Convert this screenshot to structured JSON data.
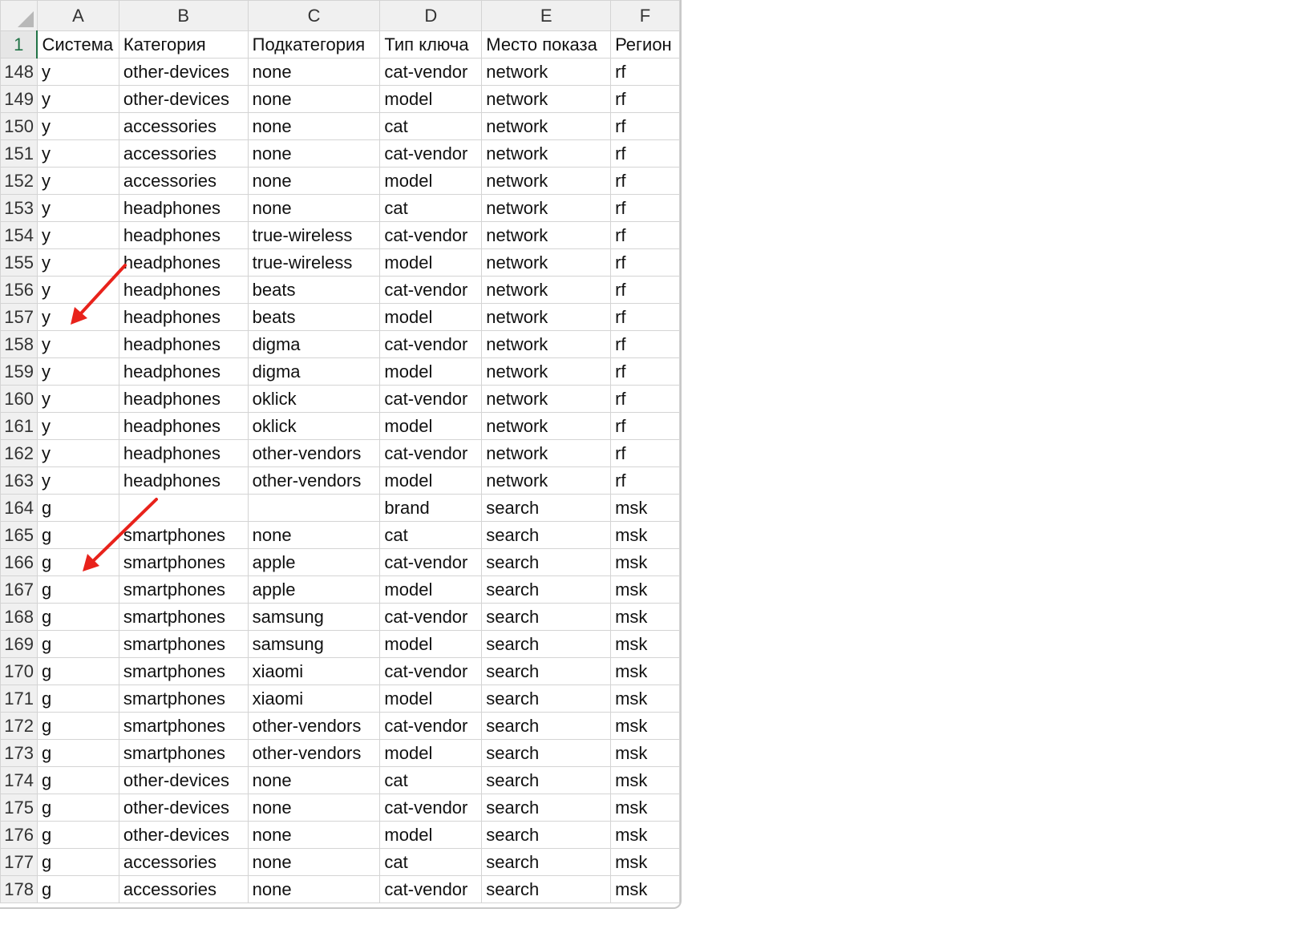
{
  "columns": [
    "A",
    "B",
    "C",
    "D",
    "E",
    "F"
  ],
  "header_row": {
    "number": "1",
    "cells": [
      "Система",
      "Категория",
      "Подкатегория",
      "Тип ключа",
      "Место показа",
      "Регион"
    ]
  },
  "rows": [
    {
      "n": "148",
      "cells": [
        "y",
        "other-devices",
        "none",
        "cat-vendor",
        "network",
        "rf"
      ]
    },
    {
      "n": "149",
      "cells": [
        "y",
        "other-devices",
        "none",
        "model",
        "network",
        "rf"
      ]
    },
    {
      "n": "150",
      "cells": [
        "y",
        "accessories",
        "none",
        "cat",
        "network",
        "rf"
      ]
    },
    {
      "n": "151",
      "cells": [
        "y",
        "accessories",
        "none",
        "cat-vendor",
        "network",
        "rf"
      ]
    },
    {
      "n": "152",
      "cells": [
        "y",
        "accessories",
        "none",
        "model",
        "network",
        "rf"
      ]
    },
    {
      "n": "153",
      "cells": [
        "y",
        "headphones",
        "none",
        "cat",
        "network",
        "rf"
      ]
    },
    {
      "n": "154",
      "cells": [
        "y",
        "headphones",
        "true-wireless",
        "cat-vendor",
        "network",
        "rf"
      ]
    },
    {
      "n": "155",
      "cells": [
        "y",
        "headphones",
        "true-wireless",
        "model",
        "network",
        "rf"
      ]
    },
    {
      "n": "156",
      "cells": [
        "y",
        "headphones",
        "beats",
        "cat-vendor",
        "network",
        "rf"
      ]
    },
    {
      "n": "157",
      "cells": [
        "y",
        "headphones",
        "beats",
        "model",
        "network",
        "rf"
      ]
    },
    {
      "n": "158",
      "cells": [
        "y",
        "headphones",
        "digma",
        "cat-vendor",
        "network",
        "rf"
      ]
    },
    {
      "n": "159",
      "cells": [
        "y",
        "headphones",
        "digma",
        "model",
        "network",
        "rf"
      ]
    },
    {
      "n": "160",
      "cells": [
        "y",
        "headphones",
        "oklick",
        "cat-vendor",
        "network",
        "rf"
      ]
    },
    {
      "n": "161",
      "cells": [
        "y",
        "headphones",
        "oklick",
        "model",
        "network",
        "rf"
      ]
    },
    {
      "n": "162",
      "cells": [
        "y",
        "headphones",
        "other-vendors",
        "cat-vendor",
        "network",
        "rf"
      ]
    },
    {
      "n": "163",
      "cells": [
        "y",
        "headphones",
        "other-vendors",
        "model",
        "network",
        "rf"
      ]
    },
    {
      "n": "164",
      "cells": [
        "g",
        "",
        "",
        "brand",
        "search",
        "msk"
      ]
    },
    {
      "n": "165",
      "cells": [
        "g",
        "smartphones",
        "none",
        "cat",
        "search",
        "msk"
      ]
    },
    {
      "n": "166",
      "cells": [
        "g",
        "smartphones",
        "apple",
        "cat-vendor",
        "search",
        "msk"
      ]
    },
    {
      "n": "167",
      "cells": [
        "g",
        "smartphones",
        "apple",
        "model",
        "search",
        "msk"
      ]
    },
    {
      "n": "168",
      "cells": [
        "g",
        "smartphones",
        "samsung",
        "cat-vendor",
        "search",
        "msk"
      ]
    },
    {
      "n": "169",
      "cells": [
        "g",
        "smartphones",
        "samsung",
        "model",
        "search",
        "msk"
      ]
    },
    {
      "n": "170",
      "cells": [
        "g",
        "smartphones",
        "xiaomi",
        "cat-vendor",
        "search",
        "msk"
      ]
    },
    {
      "n": "171",
      "cells": [
        "g",
        "smartphones",
        "xiaomi",
        "model",
        "search",
        "msk"
      ]
    },
    {
      "n": "172",
      "cells": [
        "g",
        "smartphones",
        "other-vendors",
        "cat-vendor",
        "search",
        "msk"
      ]
    },
    {
      "n": "173",
      "cells": [
        "g",
        "smartphones",
        "other-vendors",
        "model",
        "search",
        "msk"
      ]
    },
    {
      "n": "174",
      "cells": [
        "g",
        "other-devices",
        "none",
        "cat",
        "search",
        "msk"
      ]
    },
    {
      "n": "175",
      "cells": [
        "g",
        "other-devices",
        "none",
        "cat-vendor",
        "search",
        "msk"
      ]
    },
    {
      "n": "176",
      "cells": [
        "g",
        "other-devices",
        "none",
        "model",
        "search",
        "msk"
      ]
    },
    {
      "n": "177",
      "cells": [
        "g",
        "accessories",
        "none",
        "cat",
        "search",
        "msk"
      ]
    },
    {
      "n": "178",
      "cells": [
        "g",
        "accessories",
        "none",
        "cat-vendor",
        "search",
        "msk"
      ]
    }
  ],
  "colors": {
    "annotation_arrow": "#e8221b",
    "active_row_header": "#217346",
    "gridline": "#d4d4d4",
    "header_bg": "#f0f0f0"
  },
  "annotations": [
    {
      "icon": "arrow-icon",
      "points_to": "A157"
    },
    {
      "icon": "arrow-icon",
      "points_to": "A166"
    }
  ]
}
